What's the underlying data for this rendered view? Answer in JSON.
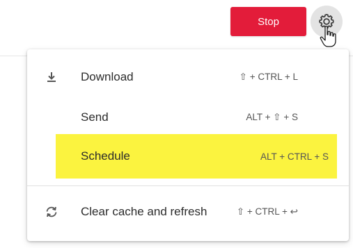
{
  "toolbar": {
    "stop_label": "Stop",
    "settings_icon": "gear-icon",
    "cursor_icon": "hand-pointer-icon"
  },
  "menu": {
    "items": [
      {
        "label": "Download",
        "shortcut": "⇧ + CTRL + L",
        "icon": "download-icon"
      },
      {
        "label": "Send",
        "shortcut": "ALT + ⇧ + S",
        "icon": ""
      },
      {
        "label": "Schedule",
        "shortcut": "ALT + CTRL + S",
        "icon": "",
        "highlighted": true
      },
      {
        "label": "Clear cache and refresh",
        "shortcut": "⇧ + CTRL + ↩",
        "icon": "refresh-icon"
      }
    ]
  },
  "colors": {
    "stop_button": "#e31c3a",
    "highlight": "#fbf33f",
    "gear_background": "#e3e3e3"
  }
}
